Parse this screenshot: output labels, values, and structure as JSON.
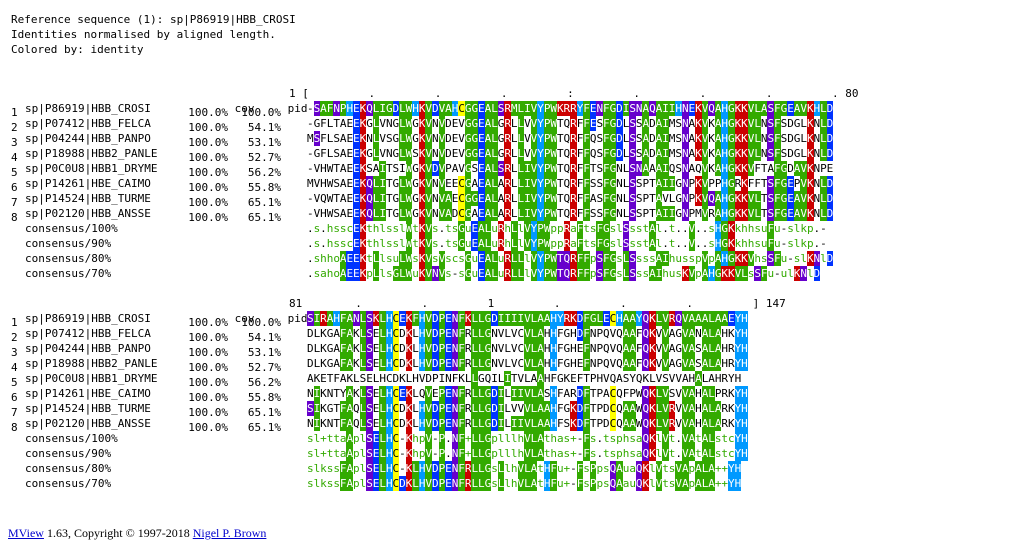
{
  "header": {
    "line1": "Reference sequence (1): sp|P86919|HBB_CROSI",
    "line2": "Identities normalised by aligned length.",
    "line3": "Colored by: identity"
  },
  "colors": {
    "green": "#33aa00",
    "blue": "#0033ff",
    "red": "#cc0000",
    "purple": "#6600cc",
    "light_blue": "#0099ff",
    "yellow": "#ffff00",
    "link": "#0000cc"
  },
  "block1": {
    "head_cov": "cov",
    "head_pid": "pid",
    "ruler": "1 [         .         .         .         :         .         .         .         . 80",
    "rows": [
      {
        "num": "1",
        "label": "sp|P86919|HBB_CROSI",
        "cov": "100.0%",
        "pid": "100.0%",
        "seq": "-SAFNPHEKQLIGDLWHKVDVAHCGGEALSRMLIVYPWKRRYFENFGDISNAQAIIHNEKVQAHGKKVLASFGEAVKHLD"
      },
      {
        "num": "2",
        "label": "sp|P07412|HBB_FELCA",
        "cov": "100.0%",
        "pid": "54.1%",
        "seq": "-GFLTAEEKGLVNGLWGKVNVDEVGGEALGRLLVVYPWTQRFFESFGDLSSADAIMSNAKVKAHGKKVLNSFSDGLKNLD"
      },
      {
        "num": "3",
        "label": "sp|P04244|HBB_PANPO",
        "cov": "100.0%",
        "pid": "53.1%",
        "seq": "MSFLSAEEKNLVSGLWGKVNVDEVGGEALGRLLVVYPWTQRFFQSFGDLSSADAIMSNAKVKAHGKKVLNSFSDGLKNLD"
      },
      {
        "num": "4",
        "label": "sp|P18988|HBB2_PANLE",
        "cov": "100.0%",
        "pid": "52.7%",
        "seq": "-GFLSAEEKGLVNGLWSKVNVDEVGGEALGRLLVVYPWTQRFFQSFGDLSSADAIMSNAKVKAHGKKVLNSFSDGLKNLD"
      },
      {
        "num": "5",
        "label": "sp|P0C0U8|HBB1_DRYME",
        "cov": "100.0%",
        "pid": "56.2%",
        "seq": "-VHWTAEEKSAITSIWGKVDVPAVGSEALSRLLIVYPWTQRFFTSFGNLSNAAAIQSNAQVKAHGKKVFTAFGDAVKNPE"
      },
      {
        "num": "6",
        "label": "sp|P14261|HBE_CAIMO",
        "cov": "100.0%",
        "pid": "55.8%",
        "seq": "MVHWSAEEKQLITGLWGKVNVEECGAEALARLLIVYPWTQRFFSSFGNLSSPTAIIGNPKVPPHGRKFFTSFGEPVKNLD"
      },
      {
        "num": "7",
        "label": "sp|P14524|HBB_TURME",
        "cov": "100.0%",
        "pid": "65.1%",
        "seq": "-VQWTAEEKQLITGLWGKVNVAECGGEALARLLIVYPWTQRFFASFGNLSSPTAVLGNPKVQAHGKKVLTSFGEAVKNLD"
      },
      {
        "num": "8",
        "label": "sp|P02120|HBB_ANSSE",
        "cov": "100.0%",
        "pid": "65.1%",
        "seq": "-VHWSAEEKQLITGLWGKVNVADCGAEALARLLIVYPWTQRFFSSFGNLSSPTAIIGNPMVRAHGKKVLTSFGEAVKNLD"
      }
    ],
    "consensus": [
      {
        "label": "consensus/100%",
        "seq": ".s.hsscEKthlsslWtKVs.tsGuEALuRhLlVYPWppRaFtsFGslSsstAl.t..V..sHGKkhhsuFu-slkp.-"
      },
      {
        "label": "consensus/90%",
        "seq": ".s.hsscEKthlsslWtKVs.tsGuEALuRhLlVYPWppRaFtsFGslSsstAl.t..V..sHGKkhhsuFu-slkp.-"
      },
      {
        "label": "consensus/80%",
        "seq": ".shhoAEEKtLlsuLWsKVsVscsGuEALuRLLlVYPWTQRFFpSFGsLSsssAIhusspVpAHGKKVhsSFu-slKNlD"
      },
      {
        "label": "consensus/70%",
        "seq": ".sahoAEEKpLlsGLWuKVNVs-sGuEALuRLLlVYPWTQRFFpSFGsLSssAIhusKVpAHGKKVLsSFu-ulKNlD"
      }
    ]
  },
  "block2": {
    "head_cov": "cov",
    "head_pid": "pid",
    "ruler": "81        .         .         1         .         .         .         ] 147",
    "rows": [
      {
        "num": "1",
        "label": "sp|P86919|HBB_CROSI",
        "cov": "100.0%",
        "pid": "100.0%",
        "seq": "SIRAHFANLSKLHCEKFHVDPENFKLLGDIIIIVLAAHYRKDFGLECHAAYQKLVRQVAAALAAEYH"
      },
      {
        "num": "2",
        "label": "sp|P07412|HBB_FELCA",
        "cov": "100.0%",
        "pid": "54.1%",
        "seq": "DLKGAFAKLSELHCDKLHVDPENFRLLGNVLVCVLAHHFGHDFNPQVQAAFQKVVAGVANALAHKYH"
      },
      {
        "num": "3",
        "label": "sp|P04244|HBB_PANPO",
        "cov": "100.0%",
        "pid": "53.1%",
        "seq": "DLKGAFAKLSELHCDKLHVDPENFRLLGNVLVCVLAHHFGHEFNPQVQAAFQKVVAGVASALAHRYH"
      },
      {
        "num": "4",
        "label": "sp|P18988|HBB2_PANLE",
        "cov": "100.0%",
        "pid": "52.7%",
        "seq": "DLKGAFAKLSELHCDKLHVDPENFRLLGNVLVCVLAHHFGHEFNPQVQAAFQKVVAGVASALAHRYH"
      },
      {
        "num": "5",
        "label": "sp|P0C0U8|HBB1_DRYME",
        "cov": "100.0%",
        "pid": "56.2%",
        "seq": "AKETFAKLSELHCDKLHVDPINFKLLGQILITVLAAHFGKEFTPHVQASYQKLVSVVAHALAHRYH"
      },
      {
        "num": "6",
        "label": "sp|P14261|HBE_CAIMO",
        "cov": "100.0%",
        "pid": "55.8%",
        "seq": "NIKNTYAKLSELHCEKLQVEPENFRLLGDILIIVLASHFARDFTPACQFPWQKLVSVVAHALPRKYH"
      },
      {
        "num": "7",
        "label": "sp|P14524|HBB_TURME",
        "cov": "100.0%",
        "pid": "65.1%",
        "seq": "SIKGTFAQLSELHCDKLHVDPENFRLLGDILVVVLAAHFGKDFTPDCQAAWQKLVRVVAHALARKYH"
      },
      {
        "num": "8",
        "label": "sp|P02120|HBB_ANSSE",
        "cov": "100.0%",
        "pid": "65.1%",
        "seq": "NIKNTFAQLSELHCDKLHVDPENFRLLGDILIIVLAAHFSKDFTPDCQAAWQKLVRVVAHALARKYH"
      }
    ],
    "consensus": [
      {
        "label": "consensus/100%",
        "seq": "sl+ttaAplSELHC-KhpV-P.NF+LLGplllhVLAthas+-Fs.tsphsaQKlVt.VAtALstcYH"
      },
      {
        "label": "consensus/90%",
        "seq": "sl+ttaAplSELHC-KhpV-P.NF+LLGplllhVLAthas+-Fs.tsphsaQKlVt.VAtALstcYH"
      },
      {
        "label": "consensus/80%",
        "seq": "slkssFAplSELHC-KLHVDPENFRLLGsLlhVLAtHFu+-FsPpsQAuaQKlVtsVApALA++YH"
      },
      {
        "label": "consensus/70%",
        "seq": "slkssFAplSELHCDKLHVDPENFRLLGsLlhVLAtHFu+-FsPpsQAauQKlVtsVApALA++YH"
      }
    ]
  },
  "footer": {
    "link1": "MView",
    "text": " 1.63, Copyright © 1997-2018 ",
    "link2": "Nigel P. Brown"
  }
}
